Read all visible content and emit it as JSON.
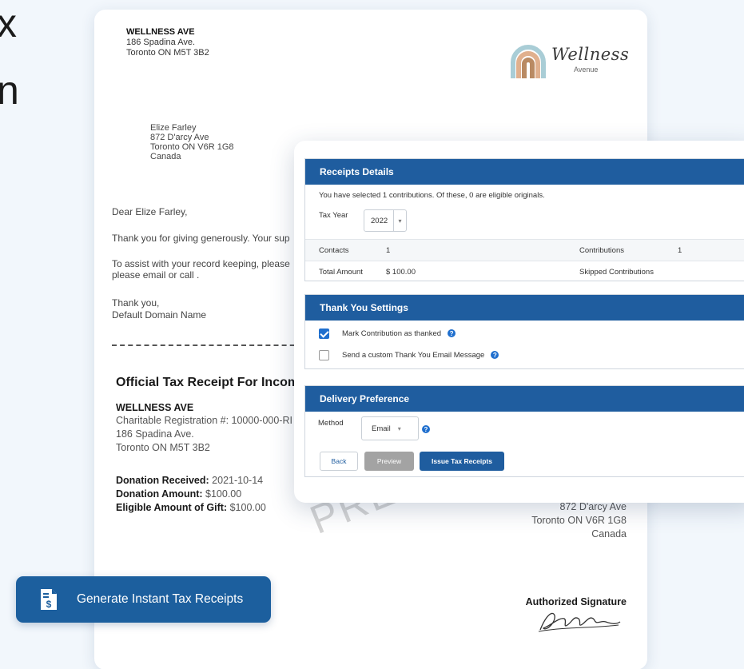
{
  "hero": {
    "line1": "x",
    "line2": "n"
  },
  "letter": {
    "org_name": "WELLNESS AVE",
    "org_address1": "186 Spadina Ave.",
    "org_address2": "Toronto ON M5T 3B2",
    "logo_word": "Wellness",
    "logo_sub": "Avenue",
    "recipient_name": "Elize Farley",
    "recipient_street": "872 D'arcy Ave",
    "recipient_city": "Toronto ON V6R 1G8",
    "recipient_country": "Canada",
    "salutation": "Dear Elize Farley,",
    "para1": "Thank you for giving generously. Your sup",
    "para2_line1": "To assist with your record keeping, please",
    "para2_line2": "please email  or call .",
    "closing": "Thank you,",
    "signoff": "Default Domain Name",
    "receipt_title": "Official Tax Receipt For Incom",
    "receipt_org": "WELLNESS AVE",
    "charity_reg": "Charitable Registration #: 10000-000-RI",
    "receipt_addr1": "186 Spadina Ave.",
    "receipt_addr2": "Toronto ON M5T 3B2",
    "donation_received_label": "Donation Received:",
    "donation_received_value": "2021-10-14",
    "donation_amount_label": "Donation Amount:",
    "donation_amount_value": "$100.00",
    "eligible_label": "Eligible Amount of Gift:",
    "eligible_value": "$100.00",
    "watermark": "PREVIEW",
    "right_street": "872 D'arcy Ave",
    "right_city": "Toronto ON V6R 1G8",
    "right_country": "Canada",
    "signature_label": "Authorized Signature"
  },
  "generate_button": {
    "label": "Generate Instant Tax Receipts",
    "icon": "dollar-document-icon"
  },
  "panel": {
    "receipts": {
      "header": "Receipts Details",
      "summary": "You have selected 1 contributions. Of these, 0 are eligible originals.",
      "tax_year_label": "Tax Year",
      "tax_year_value": "2022",
      "contacts_label": "Contacts",
      "contacts_value": "1",
      "contributions_label": "Contributions",
      "contributions_value": "1",
      "total_label": "Total Amount",
      "total_value": "$ 100.00",
      "skipped_label": "Skipped Contributions"
    },
    "thanks": {
      "header": "Thank You Settings",
      "mark_label": "Mark Contribution as thanked",
      "custom_label": "Send a custom Thank You Email Message"
    },
    "delivery": {
      "header": "Delivery Preference",
      "method_label": "Method",
      "method_value": "Email",
      "back_label": "Back",
      "preview_label": "Preview",
      "issue_label": "Issue Tax Receipts"
    }
  },
  "colors": {
    "primary": "#1f5d9f",
    "button": "#1c5f9e",
    "checkbox": "#1f6fce"
  }
}
